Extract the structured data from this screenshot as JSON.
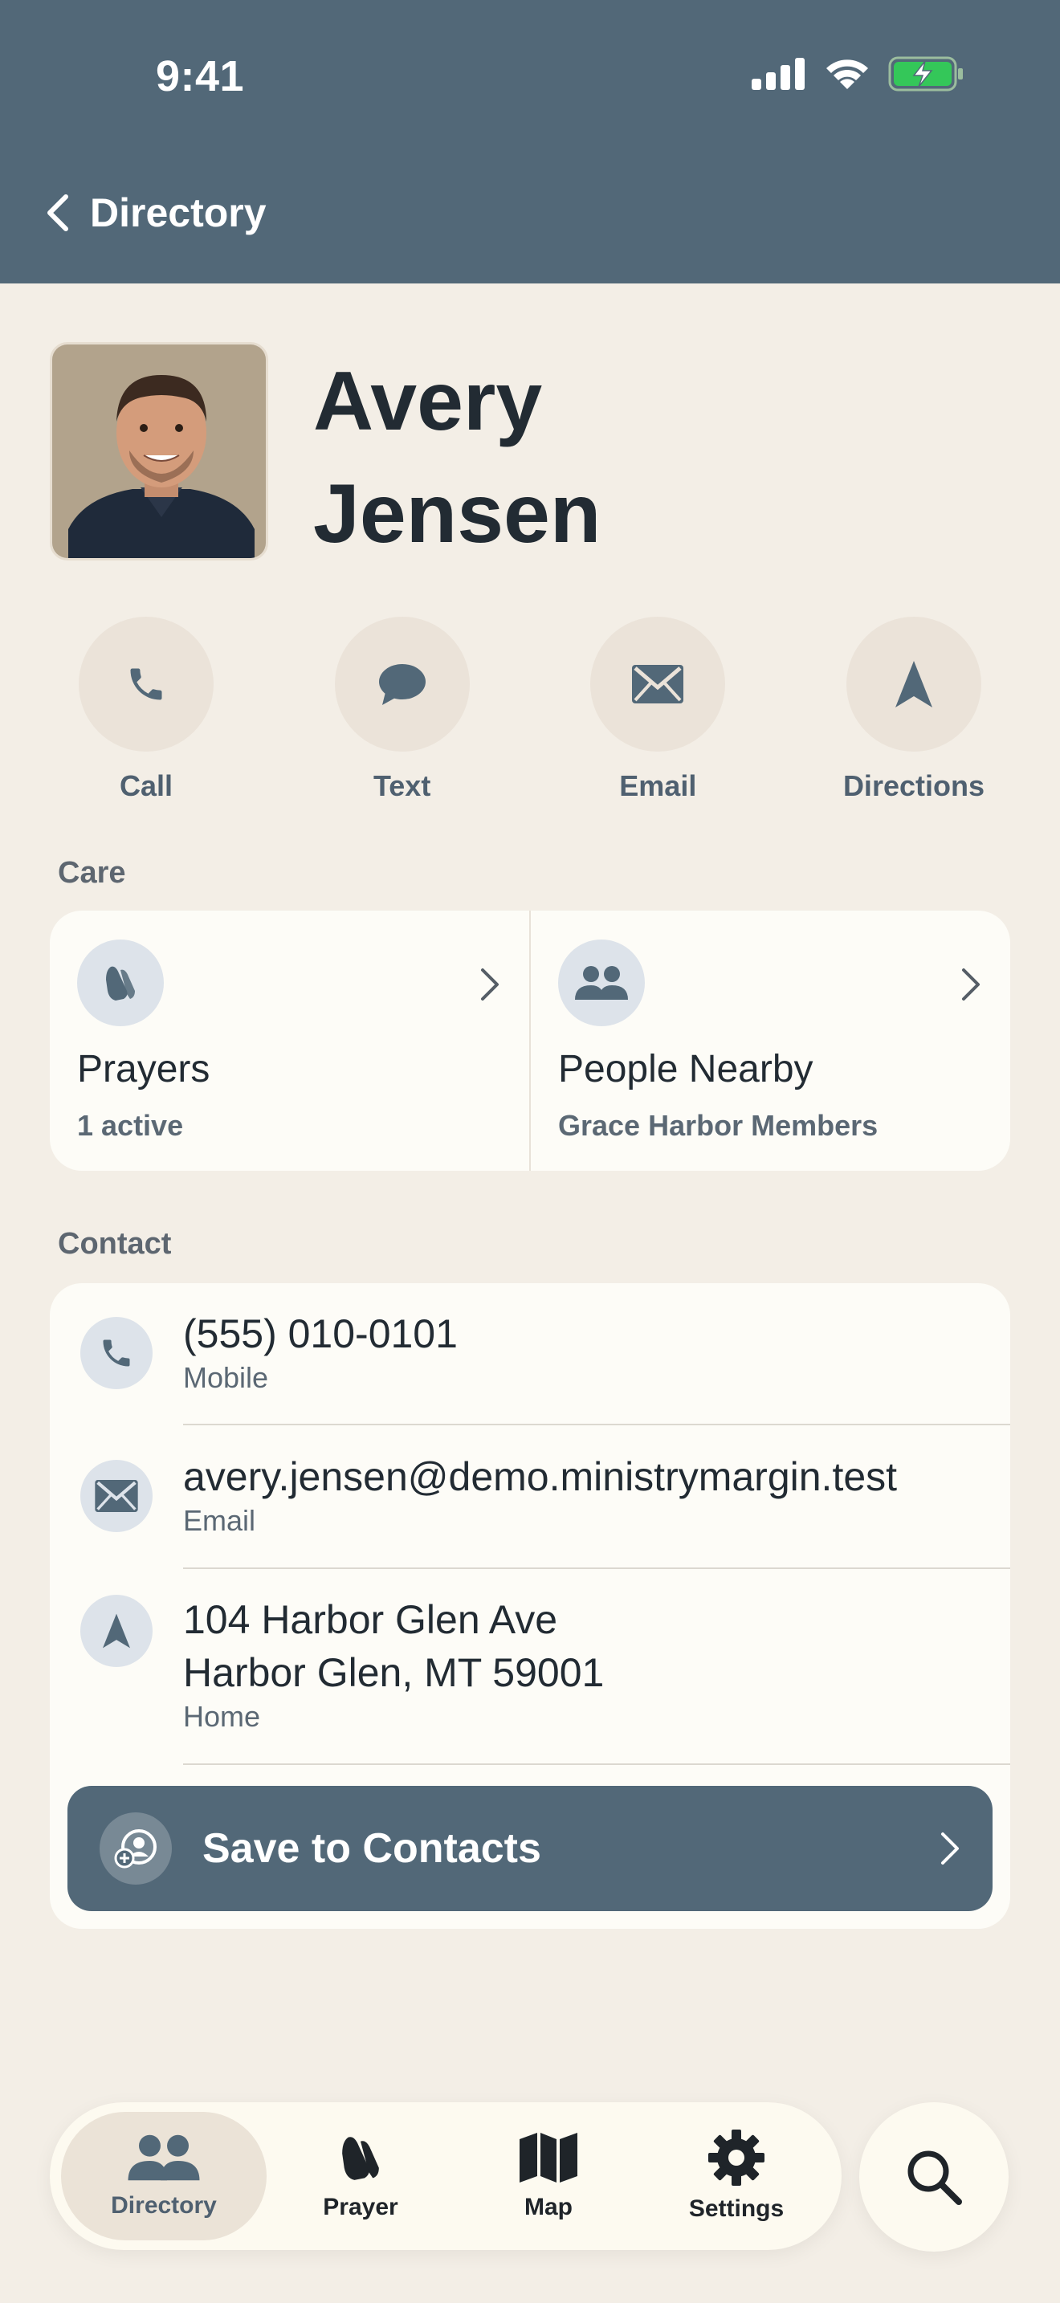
{
  "status_bar": {
    "time": "9:41"
  },
  "nav": {
    "back_label": "Directory"
  },
  "profile": {
    "first_name": "Avery",
    "last_name": "Jensen"
  },
  "actions": [
    {
      "label": "Call",
      "icon": "phone-icon"
    },
    {
      "label": "Text",
      "icon": "message-bubble-icon"
    },
    {
      "label": "Email",
      "icon": "envelope-icon"
    },
    {
      "label": "Directions",
      "icon": "navigation-arrow-icon"
    }
  ],
  "care": {
    "section_title": "Care",
    "items": [
      {
        "title": "Prayers",
        "subtitle": "1 active",
        "icon": "praying-hands-icon"
      },
      {
        "title": "People Nearby",
        "subtitle": "Grace Harbor Members",
        "icon": "people-icon"
      }
    ]
  },
  "contact": {
    "section_title": "Contact",
    "phone": {
      "value": "(555) 010-0101",
      "label": "Mobile"
    },
    "email": {
      "value": "avery.jensen@demo.ministrymargin.test",
      "label": "Email"
    },
    "address": {
      "line1": "104 Harbor Glen Ave",
      "line2": "Harbor Glen, MT 59001",
      "label": "Home"
    },
    "save_label": "Save to Contacts"
  },
  "tabbar": {
    "tabs": [
      {
        "label": "Directory",
        "active": true
      },
      {
        "label": "Prayer",
        "active": false
      },
      {
        "label": "Map",
        "active": false
      },
      {
        "label": "Settings",
        "active": false
      }
    ]
  },
  "colors": {
    "header": "#526878",
    "background": "#f3eee6",
    "card": "#fdfcf7",
    "accent": "#526878"
  }
}
